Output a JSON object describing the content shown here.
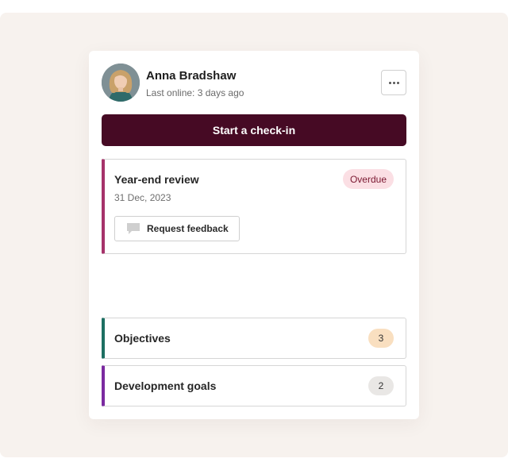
{
  "profile": {
    "name": "Anna Bradshaw",
    "last_online": "Last online: 3 days ago"
  },
  "actions": {
    "start_checkin_label": "Start a check-in"
  },
  "review": {
    "title": "Year-end review",
    "date": "31 Dec, 2023",
    "status": "Overdue",
    "request_feedback_label": "Request feedback"
  },
  "sections": [
    {
      "label": "Objectives",
      "count": "3"
    },
    {
      "label": "Development goals",
      "count": "2"
    }
  ],
  "colors": {
    "primary": "#460a24",
    "review_accent": "#a6336a",
    "objectives_accent": "#1d6f62",
    "development_accent": "#7b2aa0",
    "overdue_badge": "#fbdfe4",
    "objectives_badge": "#f9dfc0",
    "development_badge": "#e9e7e5"
  },
  "icons": {
    "menu": "more-horizontal-icon",
    "feedback": "chat-bubble-icon"
  }
}
